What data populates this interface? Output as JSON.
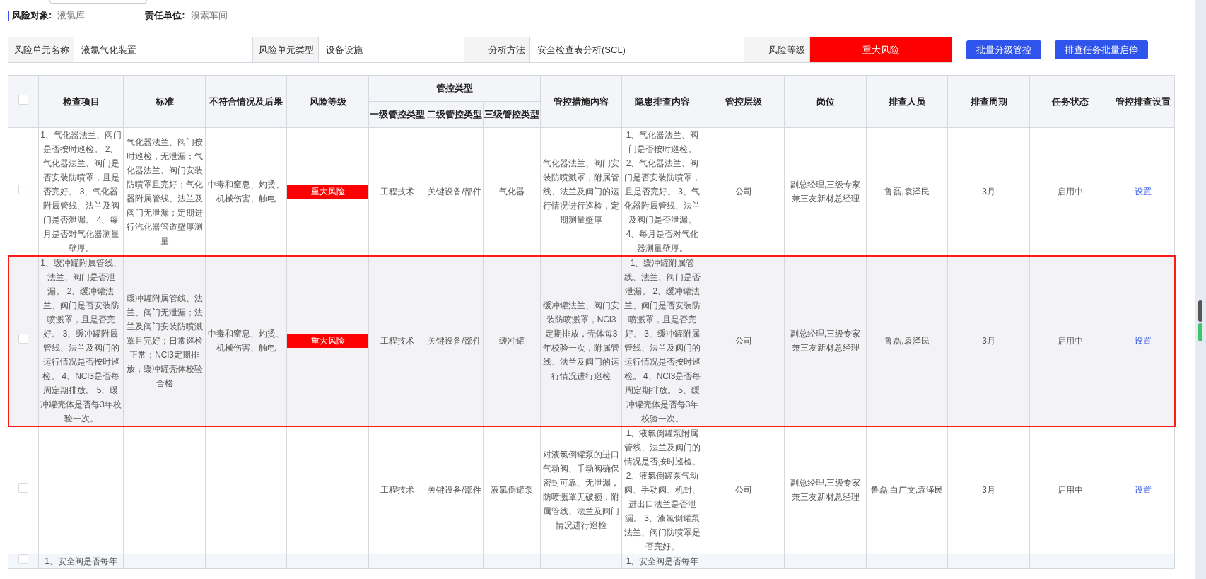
{
  "header": {
    "risk_object_label": "风险对象:",
    "risk_object": "液氯库",
    "unit_label": "责任单位:",
    "unit": "溴素车间"
  },
  "unit_info": [
    {
      "label": "风险单元名称",
      "value": "液氯气化装置"
    },
    {
      "label": "风险单元类型",
      "value": "设备设施"
    },
    {
      "label": "分析方法",
      "value": "安全检查表分析(SCL)"
    },
    {
      "label": "风险等级",
      "value": "重大风险",
      "kind": "risk"
    }
  ],
  "actions": [
    "批量分级管控",
    "排查任务批量启停"
  ],
  "table": {
    "columns": [
      {
        "label": "检查项目"
      },
      {
        "label": "标准"
      },
      {
        "label": "不符合情况及后果"
      },
      {
        "label": "风险等级"
      },
      {
        "label": "管控类型",
        "children": [
          "一级管控类型",
          "二级管控类型",
          "三级管控类型"
        ]
      },
      {
        "label": "管控措施内容"
      },
      {
        "label": "隐患排查内容"
      },
      {
        "label": "管控层级"
      },
      {
        "label": "岗位"
      },
      {
        "label": "排查人员"
      },
      {
        "label": "排查周期"
      },
      {
        "label": "任务状态"
      },
      {
        "label": "管控排查设置"
      }
    ],
    "header_checked": false,
    "rows": [
      {
        "checked": false,
        "selected": false,
        "item": "1、气化器法兰、阀门是否按时巡检。 2、气化器法兰、阀门是否安装防喷罩，且是否完好。 3、气化器附属管线、法兰及阀门是否泄漏。 4、每月是否对气化器测量壁厚。",
        "standard": "气化器法兰、阀门按时巡检，无泄漏；气化器法兰、阀门安装防喷罩且完好；气化器附属管线、法兰及阀门无泄漏；定期进行汽化器管道壁厚测量",
        "consequence": "中毒和窒息、灼烫、机械伤害、触电",
        "risk_level": "重大风险",
        "type_1": "工程技术",
        "type_2": "关键设备/部件",
        "type_3": "气化器",
        "measures": "气化器法兰、阀门安装防喷溅罩，附属管线、法兰及阀门的运行情况进行巡检，定期测量壁厚",
        "hazard_check": "1、气化器法兰、阀门是否按时巡检。 2、气化器法兰、阀门是否安装防喷罩，且是否完好。 3、气化器附属管线、法兰及阀门是否泄漏。 4、每月是否对气化器测量壁厚。",
        "control_level": "公司",
        "post": "副总经理,三级专家兼三友新材总经理",
        "inspectors": "鲁磊,袁泽民",
        "cycle": "3月",
        "status": "启用中",
        "setting": "设置"
      },
      {
        "checked": false,
        "selected": true,
        "item": "1、缓冲罐附属管线、法兰、阀门是否泄漏。 2、缓冲罐法兰、阀门是否安装防喷溅罩，且是否完好。 3、缓冲罐附属管线、法兰及阀门的运行情况是否按时巡检。 4、NCl3是否每周定期排放。 5、缓冲罐壳体是否每3年校验一次。",
        "standard": "缓冲罐附属管线、法兰、阀门无泄漏；法兰及阀门安装防喷溅罩且完好；日常巡检正常；NCl3定期排放；缓冲罐壳体校验合格",
        "consequence": "中毒和窒息、灼烫、机械伤害、触电",
        "risk_level": "重大风险",
        "type_1": "工程技术",
        "type_2": "关键设备/部件",
        "type_3": "缓冲罐",
        "measures": "缓冲罐法兰、阀门安装防喷溅罩，NCl3定期排放，壳体每3年校验一次，附属管线、法兰及阀门的运行情况进行巡检",
        "hazard_check": "1、缓冲罐附属管线、法兰、阀门是否泄漏。 2、缓冲罐法兰、阀门是否安装防喷溅罩，且是否完好。 3、缓冲罐附属管线、法兰及阀门的运行情况是否按时巡检。 4、NCl3是否每周定期排放。 5、缓冲罐壳体是否每3年校验一次。",
        "control_level": "公司",
        "post": "副总经理,三级专家兼三友新材总经理",
        "inspectors": "鲁磊,袁泽民",
        "cycle": "3月",
        "status": "启用中",
        "setting": "设置"
      },
      {
        "checked": false,
        "selected": false,
        "type_1": "工程技术",
        "type_2": "关键设备/部件",
        "type_3": "液氯倒罐泵",
        "measures": "对液氯倒罐泵的进口气动阀、手动阀确保密封可靠、无泄漏，防喷溅罩无破损，附属管线、法兰及阀门情况进行巡检",
        "hazard_check": "1、液氯倒罐泵附属管线、法兰及阀门的情况是否按时巡检。 2、液氯倒罐泵气动阀、手动阀、机封、进出口法兰是否泄漏。 3、液氯倒罐泵法兰、阀门防喷罩是否完好。",
        "control_level": "公司",
        "post": "副总经理,三级专家兼三友新材总经理",
        "inspectors": "鲁磊,白广文,袁泽民",
        "cycle": "3月",
        "status": "启用中",
        "setting": "设置"
      },
      {
        "checked": false,
        "selected": false,
        "item": "1、安全阀是否每年",
        "hazard_check": "1、安全阀是否每年"
      }
    ]
  }
}
